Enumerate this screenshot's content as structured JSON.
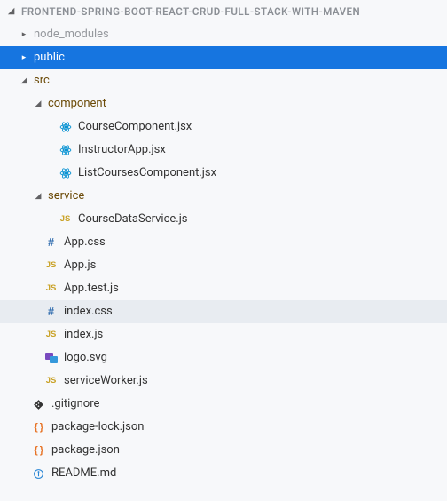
{
  "root": {
    "name": "FRONTEND-SPRING-BOOT-REACT-CRUD-FULL-STACK-WITH-MAVEN"
  },
  "tree": {
    "node_modules": "node_modules",
    "public": "public",
    "src": "src",
    "component": "component",
    "CourseComponent": "CourseComponent.jsx",
    "InstructorApp": "InstructorApp.jsx",
    "ListCoursesComponent": "ListCoursesComponent.jsx",
    "service": "service",
    "CourseDataService": "CourseDataService.js",
    "AppCss": "App.css",
    "AppJs": "App.js",
    "AppTest": "App.test.js",
    "indexCss": "index.css",
    "indexJs": "index.js",
    "logoSvg": "logo.svg",
    "serviceWorker": "serviceWorker.js",
    "gitignore": ".gitignore",
    "packageLock": "package-lock.json",
    "packageJson": "package.json",
    "readme": "README.md"
  }
}
